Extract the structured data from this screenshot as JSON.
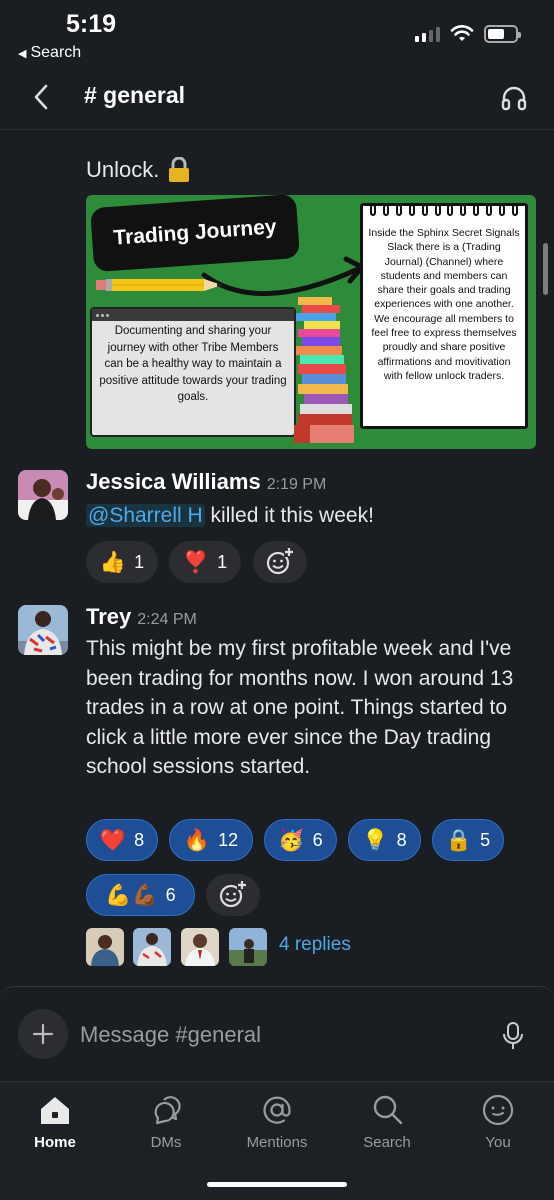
{
  "status_bar": {
    "time": "5:19",
    "back_app": "Search"
  },
  "header": {
    "channel": "# general"
  },
  "messages": {
    "unlock_text": "Unlock.",
    "image": {
      "title": "Trading Journey",
      "left_text": "Documenting and sharing your journey with other Tribe Members can be a healthy way to maintain a positive attitude towards your trading goals.",
      "right_text": "Inside the Sphinx Secret Signals Slack there is a (Trading Journal) (Channel) where students and members can share their goals and trading experiences with one another. We encourage all members to feel free to express themselves proudly and share positive affirmations and movitivation with fellow unlock traders."
    },
    "jessica": {
      "name": "Jessica Williams",
      "time": "2:19 PM",
      "mention": "@Sharrell H",
      "text": " killed it this week!",
      "reactions": [
        {
          "emoji": "👍",
          "count": "1"
        },
        {
          "emoji": "❣️",
          "count": "1"
        }
      ]
    },
    "trey": {
      "name": "Trey",
      "time": "2:24 PM",
      "text": "This might be my first profitable week and I've been trading for months now. I won around 13 trades in a row at one point. Things started to click a little more ever since the Day trading school sessions started.",
      "reactions": [
        {
          "emoji": "❤️",
          "count": "8"
        },
        {
          "emoji": "🔥",
          "count": "12"
        },
        {
          "emoji": "🥳",
          "count": "6"
        },
        {
          "emoji": "💡",
          "count": "8"
        },
        {
          "emoji": "🔒",
          "count": "5"
        },
        {
          "emoji": "💪💪🏾",
          "count": "6"
        }
      ],
      "replies": "4 replies"
    }
  },
  "composer": {
    "placeholder": "Message #general"
  },
  "tabs": [
    {
      "label": "Home",
      "icon": "home-icon"
    },
    {
      "label": "DMs",
      "icon": "dms-icon"
    },
    {
      "label": "Mentions",
      "icon": "mentions-icon"
    },
    {
      "label": "Search",
      "icon": "search-icon"
    },
    {
      "label": "You",
      "icon": "you-icon"
    }
  ],
  "colors": {
    "background": "#1a1d21",
    "link": "#4ea8e6",
    "active_reaction": "#1e4f96",
    "image_green": "#2e8b3a"
  }
}
